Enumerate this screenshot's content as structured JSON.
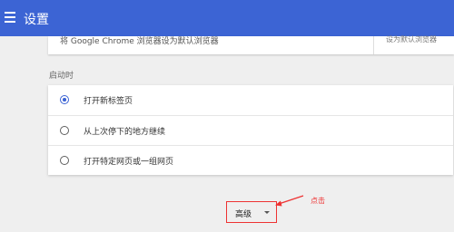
{
  "header": {
    "title": "设置",
    "menu_icon": "hamburger-menu-icon"
  },
  "default_browser": {
    "text": "将 Google Chrome 浏览器设为默认浏览器",
    "cutoff_text": "设为默认浏览器"
  },
  "startup": {
    "section_label": "启动时",
    "options": [
      {
        "label": "打开新标签页",
        "selected": true
      },
      {
        "label": "从上次停下的地方继续",
        "selected": false
      },
      {
        "label": "打开特定网页或一组网页",
        "selected": false
      }
    ]
  },
  "advanced": {
    "label": "高级",
    "caret_icon": "caret-down-icon"
  },
  "annotation": {
    "note": "点击",
    "color": "#e33333"
  },
  "colors": {
    "header_bg": "#3c64d4",
    "accent": "#3c64d4"
  }
}
